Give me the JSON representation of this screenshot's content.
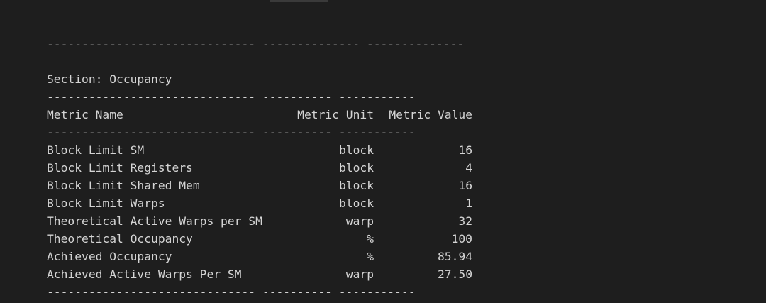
{
  "terminal": {
    "rule_top": "------------------------------ -------------- --------------",
    "section_title": "Section: Occupancy",
    "rule": "------------------------------ ---------- -----------",
    "headers": {
      "name": "Metric Name",
      "unit": "Metric Unit",
      "value": "Metric Value"
    },
    "rows": [
      {
        "name": "Block Limit SM",
        "unit": "block",
        "value": "16"
      },
      {
        "name": "Block Limit Registers",
        "unit": "block",
        "value": "4"
      },
      {
        "name": "Block Limit Shared Mem",
        "unit": "block",
        "value": "16"
      },
      {
        "name": "Block Limit Warps",
        "unit": "block",
        "value": "1"
      },
      {
        "name": "Theoretical Active Warps per SM",
        "unit": "warp",
        "value": "32"
      },
      {
        "name": "Theoretical Occupancy",
        "unit": "%",
        "value": "100"
      },
      {
        "name": "Achieved Occupancy",
        "unit": "%",
        "value": "85.94"
      },
      {
        "name": "Achieved Active Warps Per SM",
        "unit": "warp",
        "value": "27.50"
      }
    ]
  }
}
